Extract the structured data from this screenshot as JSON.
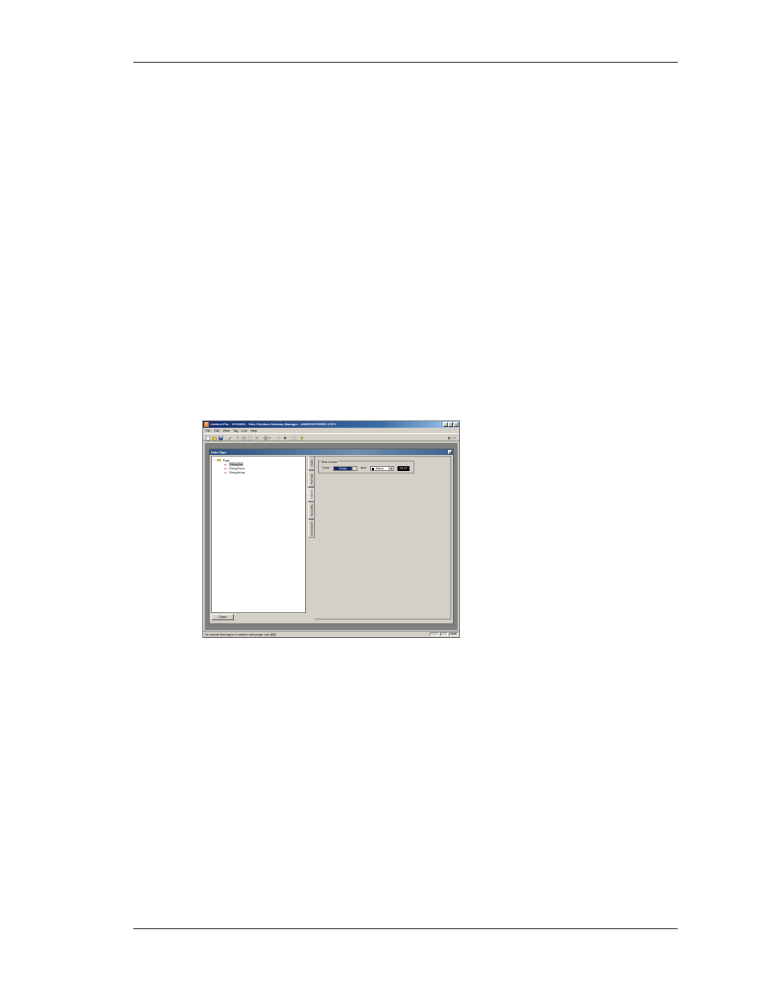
{
  "window": {
    "title": "Untitled File - VFG3000 - Vilex Fieldbus Gateway Manager - UNREGISTERED COPY",
    "app_icon": "V",
    "controls": [
      "_",
      "□",
      "×"
    ]
  },
  "menu": [
    "File",
    "Edit",
    "View",
    "Tag",
    "Link",
    "Help"
  ],
  "toolbar": {
    "icons": [
      "new-file-icon",
      "open-folder-icon",
      "save-icon",
      "edit-icon",
      "cut-icon",
      "copy-icon",
      "paste-icon",
      "delete-icon",
      "view-dropdown-icon",
      "find-icon",
      "download-icon",
      "properties-icon",
      "link-icon",
      "back-icon"
    ],
    "colors": {
      "face": "#d4d0c8",
      "accent": "#0a246a"
    }
  },
  "child_window": {
    "title": "Data Tags",
    "close_label": "x"
  },
  "tree": {
    "root": {
      "expander": "−",
      "label": "Tags"
    },
    "items": [
      {
        "label": "StringVar",
        "selected": true
      },
      {
        "label": "StringForm",
        "selected": false
      },
      {
        "label": "StringArray",
        "selected": false
      }
    ]
  },
  "tabs": [
    {
      "label": "Data",
      "active": false
    },
    {
      "label": "Format",
      "active": false
    },
    {
      "label": "Colors",
      "active": true
    },
    {
      "label": "Security",
      "active": false
    },
    {
      "label": "Comment",
      "active": false
    }
  ],
  "colors_panel": {
    "group_label": "Text Colors",
    "color_label": "Color:",
    "foreground": {
      "value": "White",
      "swatch": "#ffffff"
    },
    "and_label": "and",
    "background": {
      "value": "Black",
      "swatch": "#000000"
    },
    "preview_label": "TEXT"
  },
  "close_button": "Close",
  "status": {
    "message": "To include this tag in a custom web page, use [[0]]",
    "panes": [
      "",
      "",
      "NUM"
    ]
  }
}
